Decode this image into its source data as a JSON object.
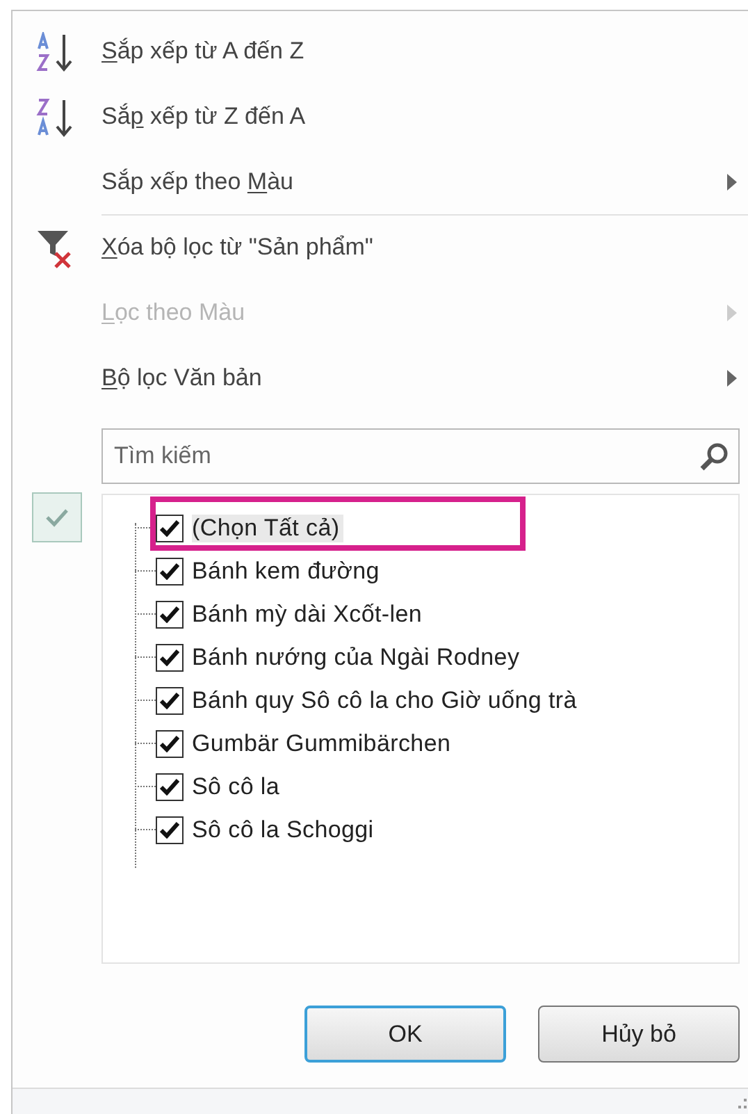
{
  "menu": {
    "items": [
      {
        "kind": "sort-az",
        "key": "S",
        "post": "ắp xếp từ A đến Z",
        "disabled": false,
        "submenu": false,
        "separator_after": false
      },
      {
        "kind": "sort-za",
        "pre": "Sắ",
        "key": "p",
        "post": " xếp từ Z đến A",
        "disabled": false,
        "submenu": false,
        "separator_after": false
      },
      {
        "kind": "plain",
        "pre": "Sắp xếp theo ",
        "key": "M",
        "post": "àu",
        "disabled": false,
        "submenu": true,
        "separator_after": true
      },
      {
        "kind": "clear-filter",
        "key": "X",
        "post": "óa bộ lọc từ \"Sản phẩm\"",
        "disabled": false,
        "submenu": false,
        "separator_after": false
      },
      {
        "kind": "plain",
        "key": "L",
        "post": "ọc theo Màu",
        "disabled": true,
        "submenu": true,
        "separator_after": false
      },
      {
        "kind": "plain",
        "key": "B",
        "post": "ộ lọc Văn bản",
        "disabled": false,
        "submenu": true,
        "separator_after": false
      }
    ]
  },
  "search": {
    "placeholder": "Tìm kiếm"
  },
  "values": [
    {
      "label": "(Chọn Tất cả)",
      "checked": true,
      "highlighted": true
    },
    {
      "label": "Bánh kem đường",
      "checked": true,
      "highlighted": false
    },
    {
      "label": "Bánh mỳ dài Xcốt-len",
      "checked": true,
      "highlighted": false
    },
    {
      "label": "Bánh nướng của Ngài Rodney",
      "checked": true,
      "highlighted": false
    },
    {
      "label": "Bánh quy Sô cô la cho Giờ uống trà",
      "checked": true,
      "highlighted": false
    },
    {
      "label": "Gumbär Gummibärchen",
      "checked": true,
      "highlighted": false
    },
    {
      "label": "Sô cô la",
      "checked": true,
      "highlighted": false
    },
    {
      "label": "Sô cô la Schoggi",
      "checked": true,
      "highlighted": false
    }
  ],
  "buttons": [
    {
      "label": "OK",
      "default": true
    },
    {
      "label": "Hủy bỏ",
      "default": false
    }
  ]
}
